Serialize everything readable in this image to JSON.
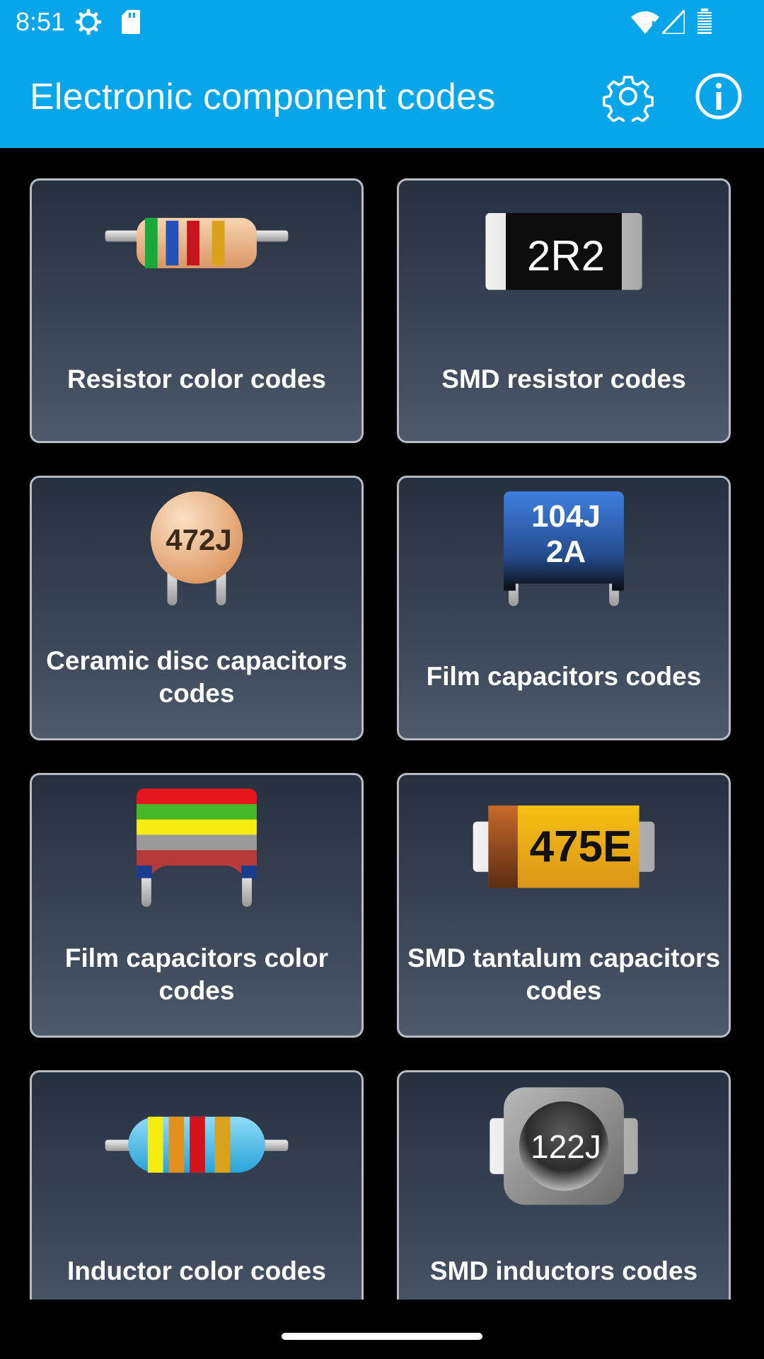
{
  "status_bar": {
    "time": "8:51"
  },
  "app_bar": {
    "title": "Electronic component codes"
  },
  "cards": [
    {
      "label": "Resistor color codes"
    },
    {
      "label": "SMD resistor codes",
      "chip_text": "2R2"
    },
    {
      "label": "Ceramic disc capacitors codes",
      "chip_text": "472J"
    },
    {
      "label": "Film capacitors codes",
      "chip_line1": "104J",
      "chip_line2": "2A"
    },
    {
      "label": "Film capacitors color codes"
    },
    {
      "label": "SMD tantalum capacitors codes",
      "chip_text": "475E"
    },
    {
      "label": "Inductor color codes"
    },
    {
      "label": "SMD inductors codes",
      "chip_text": "122J"
    }
  ],
  "colors": {
    "app_bar": "#07a6ea",
    "background": "#000000"
  }
}
